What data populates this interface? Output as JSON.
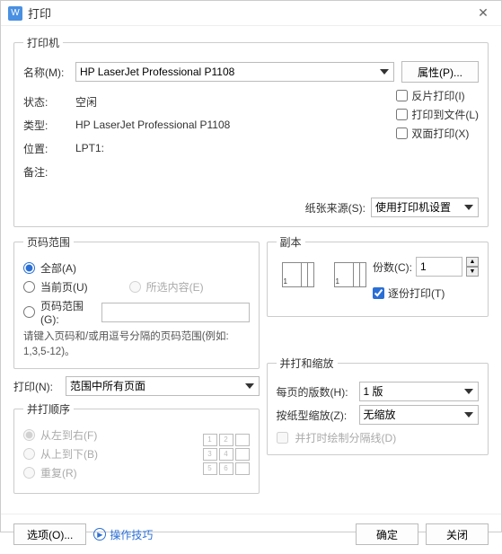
{
  "title": "打印",
  "printer": {
    "group_label": "打印机",
    "name_label": "名称(M):",
    "name_value": "HP LaserJet Professional P1108",
    "properties_btn": "属性(P)...",
    "status_label": "状态:",
    "status_value": "空闲",
    "type_label": "类型:",
    "type_value": "HP LaserJet Professional P1108",
    "location_label": "位置:",
    "location_value": "LPT1:",
    "comment_label": "备注:",
    "reverse_label": "反片打印(I)",
    "to_file_label": "打印到文件(L)",
    "duplex_label": "双面打印(X)",
    "paper_source_label": "纸张来源(S):",
    "paper_source_value": "使用打印机设置"
  },
  "range": {
    "group_label": "页码范围",
    "all_label": "全部(A)",
    "current_label": "当前页(U)",
    "selection_label": "所选内容(E)",
    "pages_label": "页码范围(G):",
    "hint": "请键入页码和/或用逗号分隔的页码范围(例如: 1,3,5-12)。",
    "print_label": "打印(N):",
    "print_value": "范围中所有页面"
  },
  "copies": {
    "group_label": "副本",
    "count_label": "份数(C):",
    "count_value": "1",
    "collate_label": "逐份打印(T)"
  },
  "order": {
    "group_label": "并打顺序",
    "ltr_label": "从左到右(F)",
    "ttb_label": "从上到下(B)",
    "repeat_label": "重复(R)"
  },
  "scale": {
    "group_label": "并打和缩放",
    "per_sheet_label": "每页的版数(H):",
    "per_sheet_value": "1 版",
    "paper_scale_label": "按纸型缩放(Z):",
    "paper_scale_value": "无缩放",
    "borders_label": "并打时绘制分隔线(D)"
  },
  "footer": {
    "options_btn": "选项(O)...",
    "tips": "操作技巧",
    "ok_btn": "确定",
    "close_btn": "关闭"
  }
}
